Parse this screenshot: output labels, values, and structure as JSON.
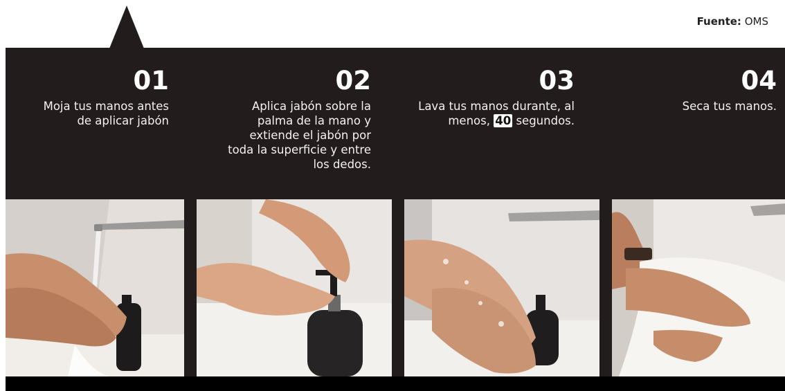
{
  "source": {
    "label": "Fuente:",
    "value": "OMS"
  },
  "steps": [
    {
      "number": "01",
      "text": "Moja tus manos antes de aplicar jabón"
    },
    {
      "number": "02",
      "text": "Aplica jabón sobre la palma de la mano y extiende el jabón por toda la superficie y entre los dedos."
    },
    {
      "number": "03",
      "text_before": "Lava tus manos durante, al menos,",
      "highlight": "40",
      "text_after": "segundos."
    },
    {
      "number": "04",
      "text": "Seca tus manos."
    }
  ],
  "colors": {
    "panel": "#231c1c",
    "bottom_bar": "#000000",
    "text": "#f4f1ee"
  }
}
